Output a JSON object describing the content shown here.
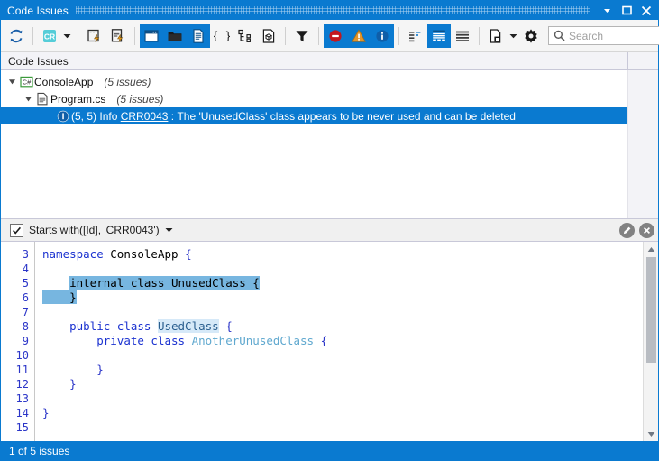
{
  "window": {
    "title": "Code Issues",
    "titlebar_buttons": [
      {
        "name": "dropdown-button",
        "glyph": "chevron-down-icon"
      },
      {
        "name": "maximize-button",
        "glyph": "maximize-icon"
      },
      {
        "name": "close-button",
        "glyph": "close-icon"
      }
    ]
  },
  "toolbar": {
    "refresh_label": "Refresh",
    "cr_badge_label": "CR",
    "items": [
      {
        "name": "refresh-button",
        "icon": "refresh-icon",
        "active": false
      },
      {
        "name": "coderush-menu-button",
        "icon": "cr-badge-icon",
        "active": false
      },
      {
        "name": "analyze-document-button",
        "icon": "analyze-document-icon",
        "active": false
      },
      {
        "name": "analyze-solution-button",
        "icon": "analyze-solution-icon",
        "active": false
      },
      {
        "name": "scope-solution-button",
        "icon": "window-icon",
        "active": true
      },
      {
        "name": "scope-project-button",
        "icon": "folder-icon",
        "active": true
      },
      {
        "name": "scope-document-button",
        "icon": "document-icon",
        "active": true
      },
      {
        "name": "scope-member-button",
        "icon": "braces-icon",
        "active": false
      },
      {
        "name": "scope-type-button",
        "icon": "hierarchy-icon",
        "active": false
      },
      {
        "name": "scope-namespace-button",
        "icon": "cube-icon",
        "active": false
      },
      {
        "name": "filter-button",
        "icon": "funnel-icon",
        "active": false
      },
      {
        "name": "show-errors-button",
        "icon": "error-icon",
        "active": true
      },
      {
        "name": "show-warnings-button",
        "icon": "warning-icon",
        "active": true
      },
      {
        "name": "show-info-button",
        "icon": "info-icon",
        "active": true
      },
      {
        "name": "group-by-category-button",
        "icon": "group-tree-icon",
        "active": false
      },
      {
        "name": "group-by-file-button",
        "icon": "group-list-icon",
        "active": true
      },
      {
        "name": "flat-list-button",
        "icon": "flat-list-icon",
        "active": false
      },
      {
        "name": "export-button",
        "icon": "export-document-icon",
        "active": false
      },
      {
        "name": "settings-button",
        "icon": "gear-icon",
        "active": false
      }
    ],
    "search": {
      "placeholder": "Search",
      "value": ""
    }
  },
  "column_header": {
    "label": "Code Issues"
  },
  "tree": {
    "nodes": [
      {
        "name": "project-node",
        "expander": "expanded",
        "icon": "csharp-project-icon",
        "icon_label": "C#",
        "label": "ConsoleApp",
        "count": "(5 issues)",
        "indent": 6,
        "selected": false
      },
      {
        "name": "file-node",
        "expander": "expanded",
        "icon": "csharp-file-icon",
        "label": "Program.cs",
        "count": "(5 issues)",
        "indent": 24,
        "selected": false
      }
    ],
    "issue": {
      "name": "issue-row",
      "icon": "info-icon",
      "indent": 60,
      "location": "(5, 5)",
      "severity": "Info",
      "rule_id": "CRR0043",
      "separator": ":",
      "message": "The 'UnusedClass' class appears to be never used and can be deleted",
      "selected": true
    }
  },
  "filter_bar": {
    "checkbox_checked": true,
    "expression": "Starts with([Id], 'CRR0043')",
    "edit_button": "edit-filter-button",
    "close_button": "clear-filter-button"
  },
  "editor": {
    "first_line": 3,
    "lines": [
      {
        "num": "3",
        "segments": [
          {
            "t": "namespace ",
            "c": "kw"
          },
          {
            "t": "ConsoleApp ",
            "c": ""
          },
          {
            "t": "{",
            "c": "brace"
          }
        ]
      },
      {
        "num": "4",
        "segments": []
      },
      {
        "num": "5",
        "segments": [
          {
            "t": "    ",
            "c": ""
          },
          {
            "t": "internal class ",
            "c": "kw sel"
          },
          {
            "t": "UnusedClass {",
            "c": "sel"
          }
        ]
      },
      {
        "num": "6",
        "segments": [
          {
            "t": "    ",
            "c": "sel"
          },
          {
            "t": "}",
            "c": "brace sel"
          }
        ]
      },
      {
        "num": "7",
        "segments": []
      },
      {
        "num": "8",
        "segments": [
          {
            "t": "    ",
            "c": ""
          },
          {
            "t": "public class ",
            "c": "kw"
          },
          {
            "t": "UsedClass",
            "c": "type-used"
          },
          {
            "t": " ",
            "c": ""
          },
          {
            "t": "{",
            "c": "brace"
          }
        ]
      },
      {
        "num": "9",
        "segments": [
          {
            "t": "        ",
            "c": ""
          },
          {
            "t": "private class ",
            "c": "kw"
          },
          {
            "t": "AnotherUnusedClass",
            "c": "type-plain"
          },
          {
            "t": " ",
            "c": ""
          },
          {
            "t": "{",
            "c": "brace"
          }
        ]
      },
      {
        "num": "10",
        "segments": []
      },
      {
        "num": "11",
        "segments": [
          {
            "t": "        ",
            "c": ""
          },
          {
            "t": "}",
            "c": "brace"
          }
        ]
      },
      {
        "num": "12",
        "segments": [
          {
            "t": "    ",
            "c": ""
          },
          {
            "t": "}",
            "c": "brace"
          }
        ]
      },
      {
        "num": "13",
        "segments": []
      },
      {
        "num": "14",
        "segments": [
          {
            "t": "}",
            "c": "brace"
          }
        ]
      },
      {
        "num": "15",
        "segments": []
      }
    ],
    "scrollbar": {
      "up": "scroll-up-arrow",
      "down": "scroll-down-arrow",
      "thumb_top_pct": 4,
      "thumb_height_pct": 62
    }
  },
  "status_bar": {
    "text": "1 of 5 issues"
  },
  "colors": {
    "accent": "#0a7ad0",
    "selection": "#0a7ad0",
    "toolbar_bg": "#f5f5f5",
    "error": "#c3171e",
    "warning": "#e3952a",
    "info": "#1177c9",
    "cr_badge": "#55cdd8",
    "code_selection": "#77b6e0",
    "line_number": "#2b35c8"
  }
}
